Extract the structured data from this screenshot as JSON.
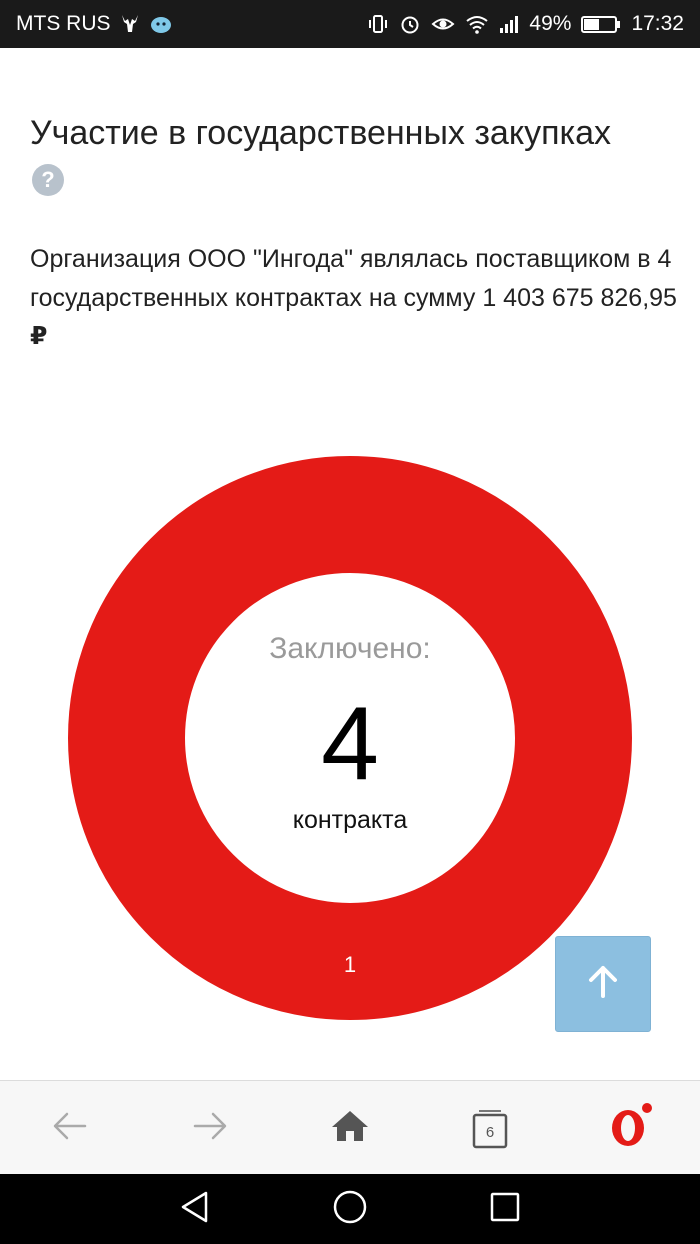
{
  "status_bar": {
    "carrier": "MTS RUS",
    "battery": "49%",
    "time": "17:32",
    "icons": [
      "deer-icon",
      "cloud-creature-icon",
      "vibrate-icon",
      "alarm-icon",
      "eye-comfort-icon",
      "wifi-icon",
      "signal-icon",
      "battery-icon"
    ]
  },
  "page": {
    "title": "Участие в государственных закупках",
    "help_icon_glyph": "?",
    "description": "Организация ООО \"Ингода\" являлась поставщиком в 4 государственных контрактах на сумму 1 403 675 826,95",
    "currency_symbol": "₽"
  },
  "chart_data": {
    "type": "pie",
    "variant": "donut",
    "center_label": "Заключено:",
    "center_value": "4",
    "center_unit": "контракта",
    "slices": [
      {
        "label": "1",
        "value": 4,
        "color": "#e41b17"
      }
    ]
  },
  "scroll_top_button": {
    "icon": "arrow-up-icon",
    "color": "#8cbfe0"
  },
  "browser_toolbar": {
    "back_icon": "arrow-left-icon",
    "forward_icon": "arrow-right-icon",
    "home_icon": "home-icon",
    "tabs_count": "6",
    "menu_icon": "opera-logo-icon",
    "accent": "#e41b17"
  },
  "nav_bar": {
    "icons": [
      "back-triangle-icon",
      "home-circle-icon",
      "recents-square-icon"
    ]
  }
}
